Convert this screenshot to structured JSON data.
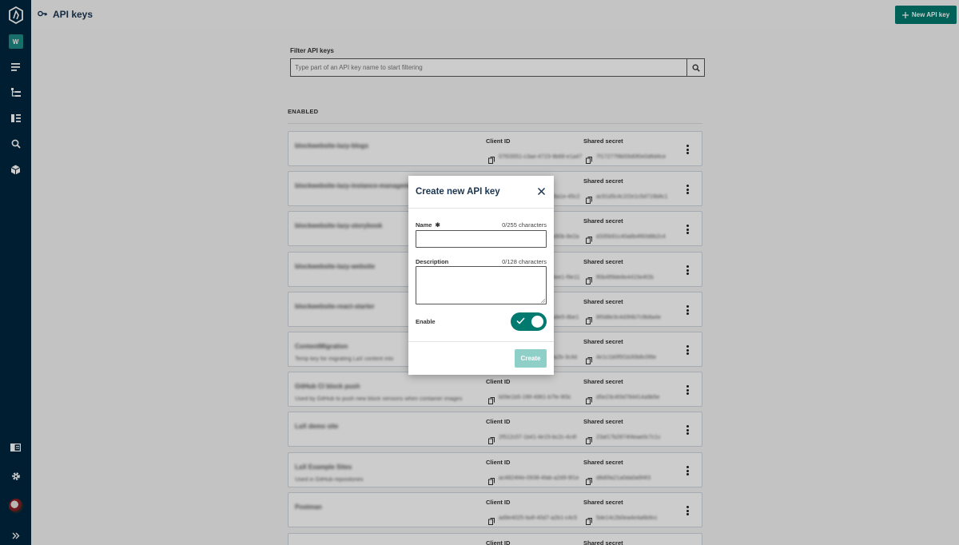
{
  "sidebar": {
    "workspace_initial": "W",
    "icons": [
      "logo-icon",
      "content-icon",
      "structure-icon",
      "pages-icon",
      "search-icon",
      "packages-icon",
      "library-icon",
      "settings-icon",
      "avatar",
      "expand-icon"
    ]
  },
  "header": {
    "title": "API keys",
    "new_button_label": "New API key"
  },
  "filter": {
    "label": "Filter API keys",
    "placeholder": "Type part of an API key name to start filtering"
  },
  "section": {
    "label": "ENABLED"
  },
  "columns": {
    "client_id": "Client ID",
    "shared_secret": "Shared secret"
  },
  "api_keys": [
    {
      "name": "blockwebsite-lazy-blogs",
      "description": "",
      "client_id": "07f03551-c3ae-4723-9b68-e1a47",
      "secret": "7f17277f8b59d0f0e0d6d4ce"
    },
    {
      "name": "blockwebsite-lazy-instance-management",
      "description": "",
      "client_id": "a4e9b6c3-1234-49c2-8a1e-45c2",
      "secret": "ac91d5c4c1f2e1c5d716b8c1"
    },
    {
      "name": "blockwebsite-lazy-storybook",
      "description": "",
      "client_id": "c2a37d0e-ef22-4bd9-a90b-8e2a",
      "secret": "d335b91c40a8b4f60d8b2c4"
    },
    {
      "name": "blockwebsite-lazy-website",
      "description": "",
      "client_id": "9a41e5c2-7b1f-4c9d-8ee1-f9e11",
      "secret": "ff0b4ff9de8e4415e4f2b"
    },
    {
      "name": "blockwebsite-react-starter",
      "description": "",
      "client_id": "1b4c9e2d-3f6a-4d7e-a8e5-8be1",
      "secret": "8f0d8e3c4d3f4b7c9b8a4e"
    },
    {
      "name": "ContentMigration",
      "description": "Temp key for migrating LaX content into",
      "client_id": "5e6f7a8b-9c0d-4e1f-8a2b-3c4d",
      "secret": "4e1c1b0f5f1b30b8c0f8e"
    },
    {
      "name": "GitHub CI block push",
      "description": "Used by GitHub to push new block versions when container images",
      "client_id": "b09e1b5-1f8f-4961-b7fe-9f3c",
      "secret": "d5e23c4f3d784414a9b5e"
    },
    {
      "name": "LaX demo site",
      "description": "",
      "client_id": "2f512c07-1b41-4e15-bc2c-4c4f",
      "secret": "23af17b2874f4eae0c7c1c"
    },
    {
      "name": "LaX Example Sites",
      "description": "Used in GitHub repositories",
      "client_id": "ac4824f4e-0938-4fab-a2d9-9f1e",
      "secret": "d8d0fa21a0da0a9f4f3"
    },
    {
      "name": "Postman",
      "description": "",
      "client_id": "ad9e4025-fa4f-40d7-a2b1-c4c5",
      "secret": "5de14c2b0ea4e4a6b9cc"
    },
    {
      "name": "",
      "description": "",
      "client_id": "",
      "secret": ""
    }
  ],
  "modal": {
    "title": "Create new API key",
    "name_label": "Name",
    "name_required_mark": "✱",
    "name_count": "0/255 characters",
    "description_label": "Description",
    "description_count": "0/128 characters",
    "enable_label": "Enable",
    "enabled": true,
    "create_label": "Create"
  },
  "colors": {
    "sidebar": "#00263e",
    "accent": "#007a6e",
    "workspace_badge": "#1e8a83",
    "create_disabled": "#8ecfc8"
  }
}
